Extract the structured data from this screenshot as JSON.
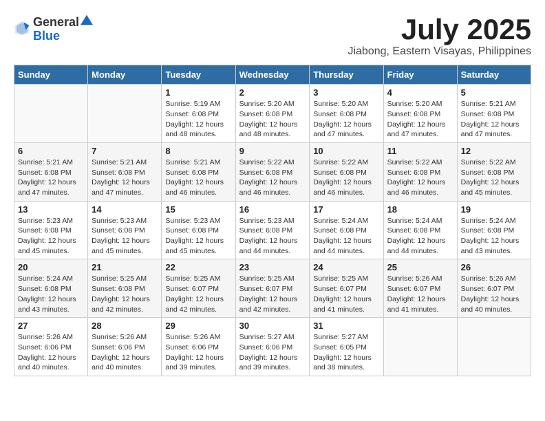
{
  "logo": {
    "text_general": "General",
    "text_blue": "Blue",
    "tagline": ""
  },
  "title": "July 2025",
  "subtitle": "Jiabong, Eastern Visayas, Philippines",
  "header_days": [
    "Sunday",
    "Monday",
    "Tuesday",
    "Wednesday",
    "Thursday",
    "Friday",
    "Saturday"
  ],
  "weeks": [
    {
      "days": [
        {
          "num": "",
          "detail": ""
        },
        {
          "num": "",
          "detail": ""
        },
        {
          "num": "1",
          "detail": "Sunrise: 5:19 AM\nSunset: 6:08 PM\nDaylight: 12 hours and 48 minutes."
        },
        {
          "num": "2",
          "detail": "Sunrise: 5:20 AM\nSunset: 6:08 PM\nDaylight: 12 hours and 48 minutes."
        },
        {
          "num": "3",
          "detail": "Sunrise: 5:20 AM\nSunset: 6:08 PM\nDaylight: 12 hours and 47 minutes."
        },
        {
          "num": "4",
          "detail": "Sunrise: 5:20 AM\nSunset: 6:08 PM\nDaylight: 12 hours and 47 minutes."
        },
        {
          "num": "5",
          "detail": "Sunrise: 5:21 AM\nSunset: 6:08 PM\nDaylight: 12 hours and 47 minutes."
        }
      ]
    },
    {
      "days": [
        {
          "num": "6",
          "detail": "Sunrise: 5:21 AM\nSunset: 6:08 PM\nDaylight: 12 hours and 47 minutes."
        },
        {
          "num": "7",
          "detail": "Sunrise: 5:21 AM\nSunset: 6:08 PM\nDaylight: 12 hours and 47 minutes."
        },
        {
          "num": "8",
          "detail": "Sunrise: 5:21 AM\nSunset: 6:08 PM\nDaylight: 12 hours and 46 minutes."
        },
        {
          "num": "9",
          "detail": "Sunrise: 5:22 AM\nSunset: 6:08 PM\nDaylight: 12 hours and 46 minutes."
        },
        {
          "num": "10",
          "detail": "Sunrise: 5:22 AM\nSunset: 6:08 PM\nDaylight: 12 hours and 46 minutes."
        },
        {
          "num": "11",
          "detail": "Sunrise: 5:22 AM\nSunset: 6:08 PM\nDaylight: 12 hours and 46 minutes."
        },
        {
          "num": "12",
          "detail": "Sunrise: 5:22 AM\nSunset: 6:08 PM\nDaylight: 12 hours and 45 minutes."
        }
      ]
    },
    {
      "days": [
        {
          "num": "13",
          "detail": "Sunrise: 5:23 AM\nSunset: 6:08 PM\nDaylight: 12 hours and 45 minutes."
        },
        {
          "num": "14",
          "detail": "Sunrise: 5:23 AM\nSunset: 6:08 PM\nDaylight: 12 hours and 45 minutes."
        },
        {
          "num": "15",
          "detail": "Sunrise: 5:23 AM\nSunset: 6:08 PM\nDaylight: 12 hours and 45 minutes."
        },
        {
          "num": "16",
          "detail": "Sunrise: 5:23 AM\nSunset: 6:08 PM\nDaylight: 12 hours and 44 minutes."
        },
        {
          "num": "17",
          "detail": "Sunrise: 5:24 AM\nSunset: 6:08 PM\nDaylight: 12 hours and 44 minutes."
        },
        {
          "num": "18",
          "detail": "Sunrise: 5:24 AM\nSunset: 6:08 PM\nDaylight: 12 hours and 44 minutes."
        },
        {
          "num": "19",
          "detail": "Sunrise: 5:24 AM\nSunset: 6:08 PM\nDaylight: 12 hours and 43 minutes."
        }
      ]
    },
    {
      "days": [
        {
          "num": "20",
          "detail": "Sunrise: 5:24 AM\nSunset: 6:08 PM\nDaylight: 12 hours and 43 minutes."
        },
        {
          "num": "21",
          "detail": "Sunrise: 5:25 AM\nSunset: 6:08 PM\nDaylight: 12 hours and 42 minutes."
        },
        {
          "num": "22",
          "detail": "Sunrise: 5:25 AM\nSunset: 6:07 PM\nDaylight: 12 hours and 42 minutes."
        },
        {
          "num": "23",
          "detail": "Sunrise: 5:25 AM\nSunset: 6:07 PM\nDaylight: 12 hours and 42 minutes."
        },
        {
          "num": "24",
          "detail": "Sunrise: 5:25 AM\nSunset: 6:07 PM\nDaylight: 12 hours and 41 minutes."
        },
        {
          "num": "25",
          "detail": "Sunrise: 5:26 AM\nSunset: 6:07 PM\nDaylight: 12 hours and 41 minutes."
        },
        {
          "num": "26",
          "detail": "Sunrise: 5:26 AM\nSunset: 6:07 PM\nDaylight: 12 hours and 40 minutes."
        }
      ]
    },
    {
      "days": [
        {
          "num": "27",
          "detail": "Sunrise: 5:26 AM\nSunset: 6:06 PM\nDaylight: 12 hours and 40 minutes."
        },
        {
          "num": "28",
          "detail": "Sunrise: 5:26 AM\nSunset: 6:06 PM\nDaylight: 12 hours and 40 minutes."
        },
        {
          "num": "29",
          "detail": "Sunrise: 5:26 AM\nSunset: 6:06 PM\nDaylight: 12 hours and 39 minutes."
        },
        {
          "num": "30",
          "detail": "Sunrise: 5:27 AM\nSunset: 6:06 PM\nDaylight: 12 hours and 39 minutes."
        },
        {
          "num": "31",
          "detail": "Sunrise: 5:27 AM\nSunset: 6:05 PM\nDaylight: 12 hours and 38 minutes."
        },
        {
          "num": "",
          "detail": ""
        },
        {
          "num": "",
          "detail": ""
        }
      ]
    }
  ]
}
